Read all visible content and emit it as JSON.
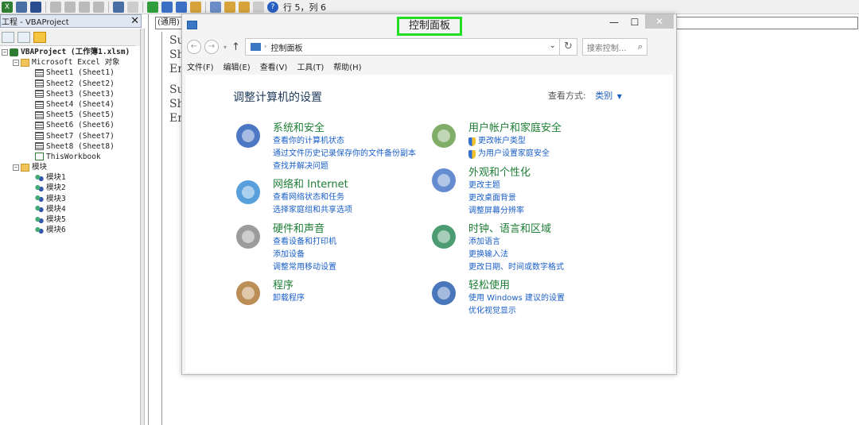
{
  "vba": {
    "toolbar": {
      "position": "行 5，列 6"
    },
    "project": {
      "title": "工程 - VBAProject",
      "close": "✕",
      "tree": [
        {
          "label": "VBAProject (工作簿1.xlsm)",
          "level": 0,
          "kind": "proj",
          "expander": "−"
        },
        {
          "label": "Microsoft Excel 对象",
          "level": 1,
          "kind": "folder",
          "expander": "−"
        },
        {
          "label": "Sheet1 (Sheet1)",
          "level": 2,
          "kind": "sheet"
        },
        {
          "label": "Sheet2 (Sheet2)",
          "level": 2,
          "kind": "sheet"
        },
        {
          "label": "Sheet3 (Sheet3)",
          "level": 2,
          "kind": "sheet"
        },
        {
          "label": "Sheet4 (Sheet4)",
          "level": 2,
          "kind": "sheet"
        },
        {
          "label": "Sheet5 (Sheet5)",
          "level": 2,
          "kind": "sheet"
        },
        {
          "label": "Sheet6 (Sheet6)",
          "level": 2,
          "kind": "sheet"
        },
        {
          "label": "Sheet7 (Sheet7)",
          "level": 2,
          "kind": "sheet"
        },
        {
          "label": "Sheet8 (Sheet8)",
          "level": 2,
          "kind": "sheet"
        },
        {
          "label": "ThisWorkbook",
          "level": 2,
          "kind": "wb"
        },
        {
          "label": "模块",
          "level": 1,
          "kind": "folder",
          "expander": "−"
        },
        {
          "label": "模块1",
          "level": 2,
          "kind": "mod"
        },
        {
          "label": "模块2",
          "level": 2,
          "kind": "mod"
        },
        {
          "label": "模块3",
          "level": 2,
          "kind": "mod"
        },
        {
          "label": "模块4",
          "level": 2,
          "kind": "mod"
        },
        {
          "label": "模块5",
          "level": 2,
          "kind": "mod"
        },
        {
          "label": "模块6",
          "level": 2,
          "kind": "mod"
        }
      ]
    },
    "code": {
      "object_combo": "(通用)",
      "lines_a": [
        "Su",
        "Sh",
        "En"
      ],
      "lines_b": [
        "Su",
        "Sh",
        "En"
      ]
    }
  },
  "control_panel": {
    "window_title": "控制面板",
    "address": {
      "crumb": "控制面板",
      "search_placeholder": "搜索控制..."
    },
    "menu": [
      "文件(F)",
      "编辑(E)",
      "查看(V)",
      "工具(T)",
      "帮助(H)"
    ],
    "heading": "调整计算机的设置",
    "view_by_label": "查看方式:",
    "view_by_value": "类别",
    "categories": [
      {
        "title": "系统和安全",
        "icon": "security-shield-icon",
        "links": [
          "查看你的计算机状态",
          "通过文件历史记录保存你的文件备份副本",
          "查找并解决问题"
        ]
      },
      {
        "title": "网络和 Internet",
        "icon": "network-globe-icon",
        "links": [
          "查看网络状态和任务",
          "选择家庭组和共享选项"
        ]
      },
      {
        "title": "硬件和声音",
        "icon": "printer-speaker-icon",
        "links": [
          "查看设备和打印机",
          "添加设备",
          "调整常用移动设置"
        ]
      },
      {
        "title": "程序",
        "icon": "programs-box-icon",
        "links": [
          "卸载程序"
        ]
      },
      {
        "title": "用户帐户和家庭安全",
        "icon": "users-icon",
        "links": [
          "更改帐户类型",
          "为用户设置家庭安全"
        ]
      },
      {
        "title": "外观和个性化",
        "icon": "display-palette-icon",
        "links": [
          "更改主题",
          "更改桌面背景",
          "调整屏幕分辨率"
        ]
      },
      {
        "title": "时钟、语言和区域",
        "icon": "clock-globe-icon",
        "links": [
          "添加语言",
          "更换输入法",
          "更改日期、时间或数字格式"
        ]
      },
      {
        "title": "轻松使用",
        "icon": "ease-of-access-icon",
        "links": [
          "使用 Windows 建议的设置",
          "优化视觉显示"
        ]
      }
    ]
  }
}
